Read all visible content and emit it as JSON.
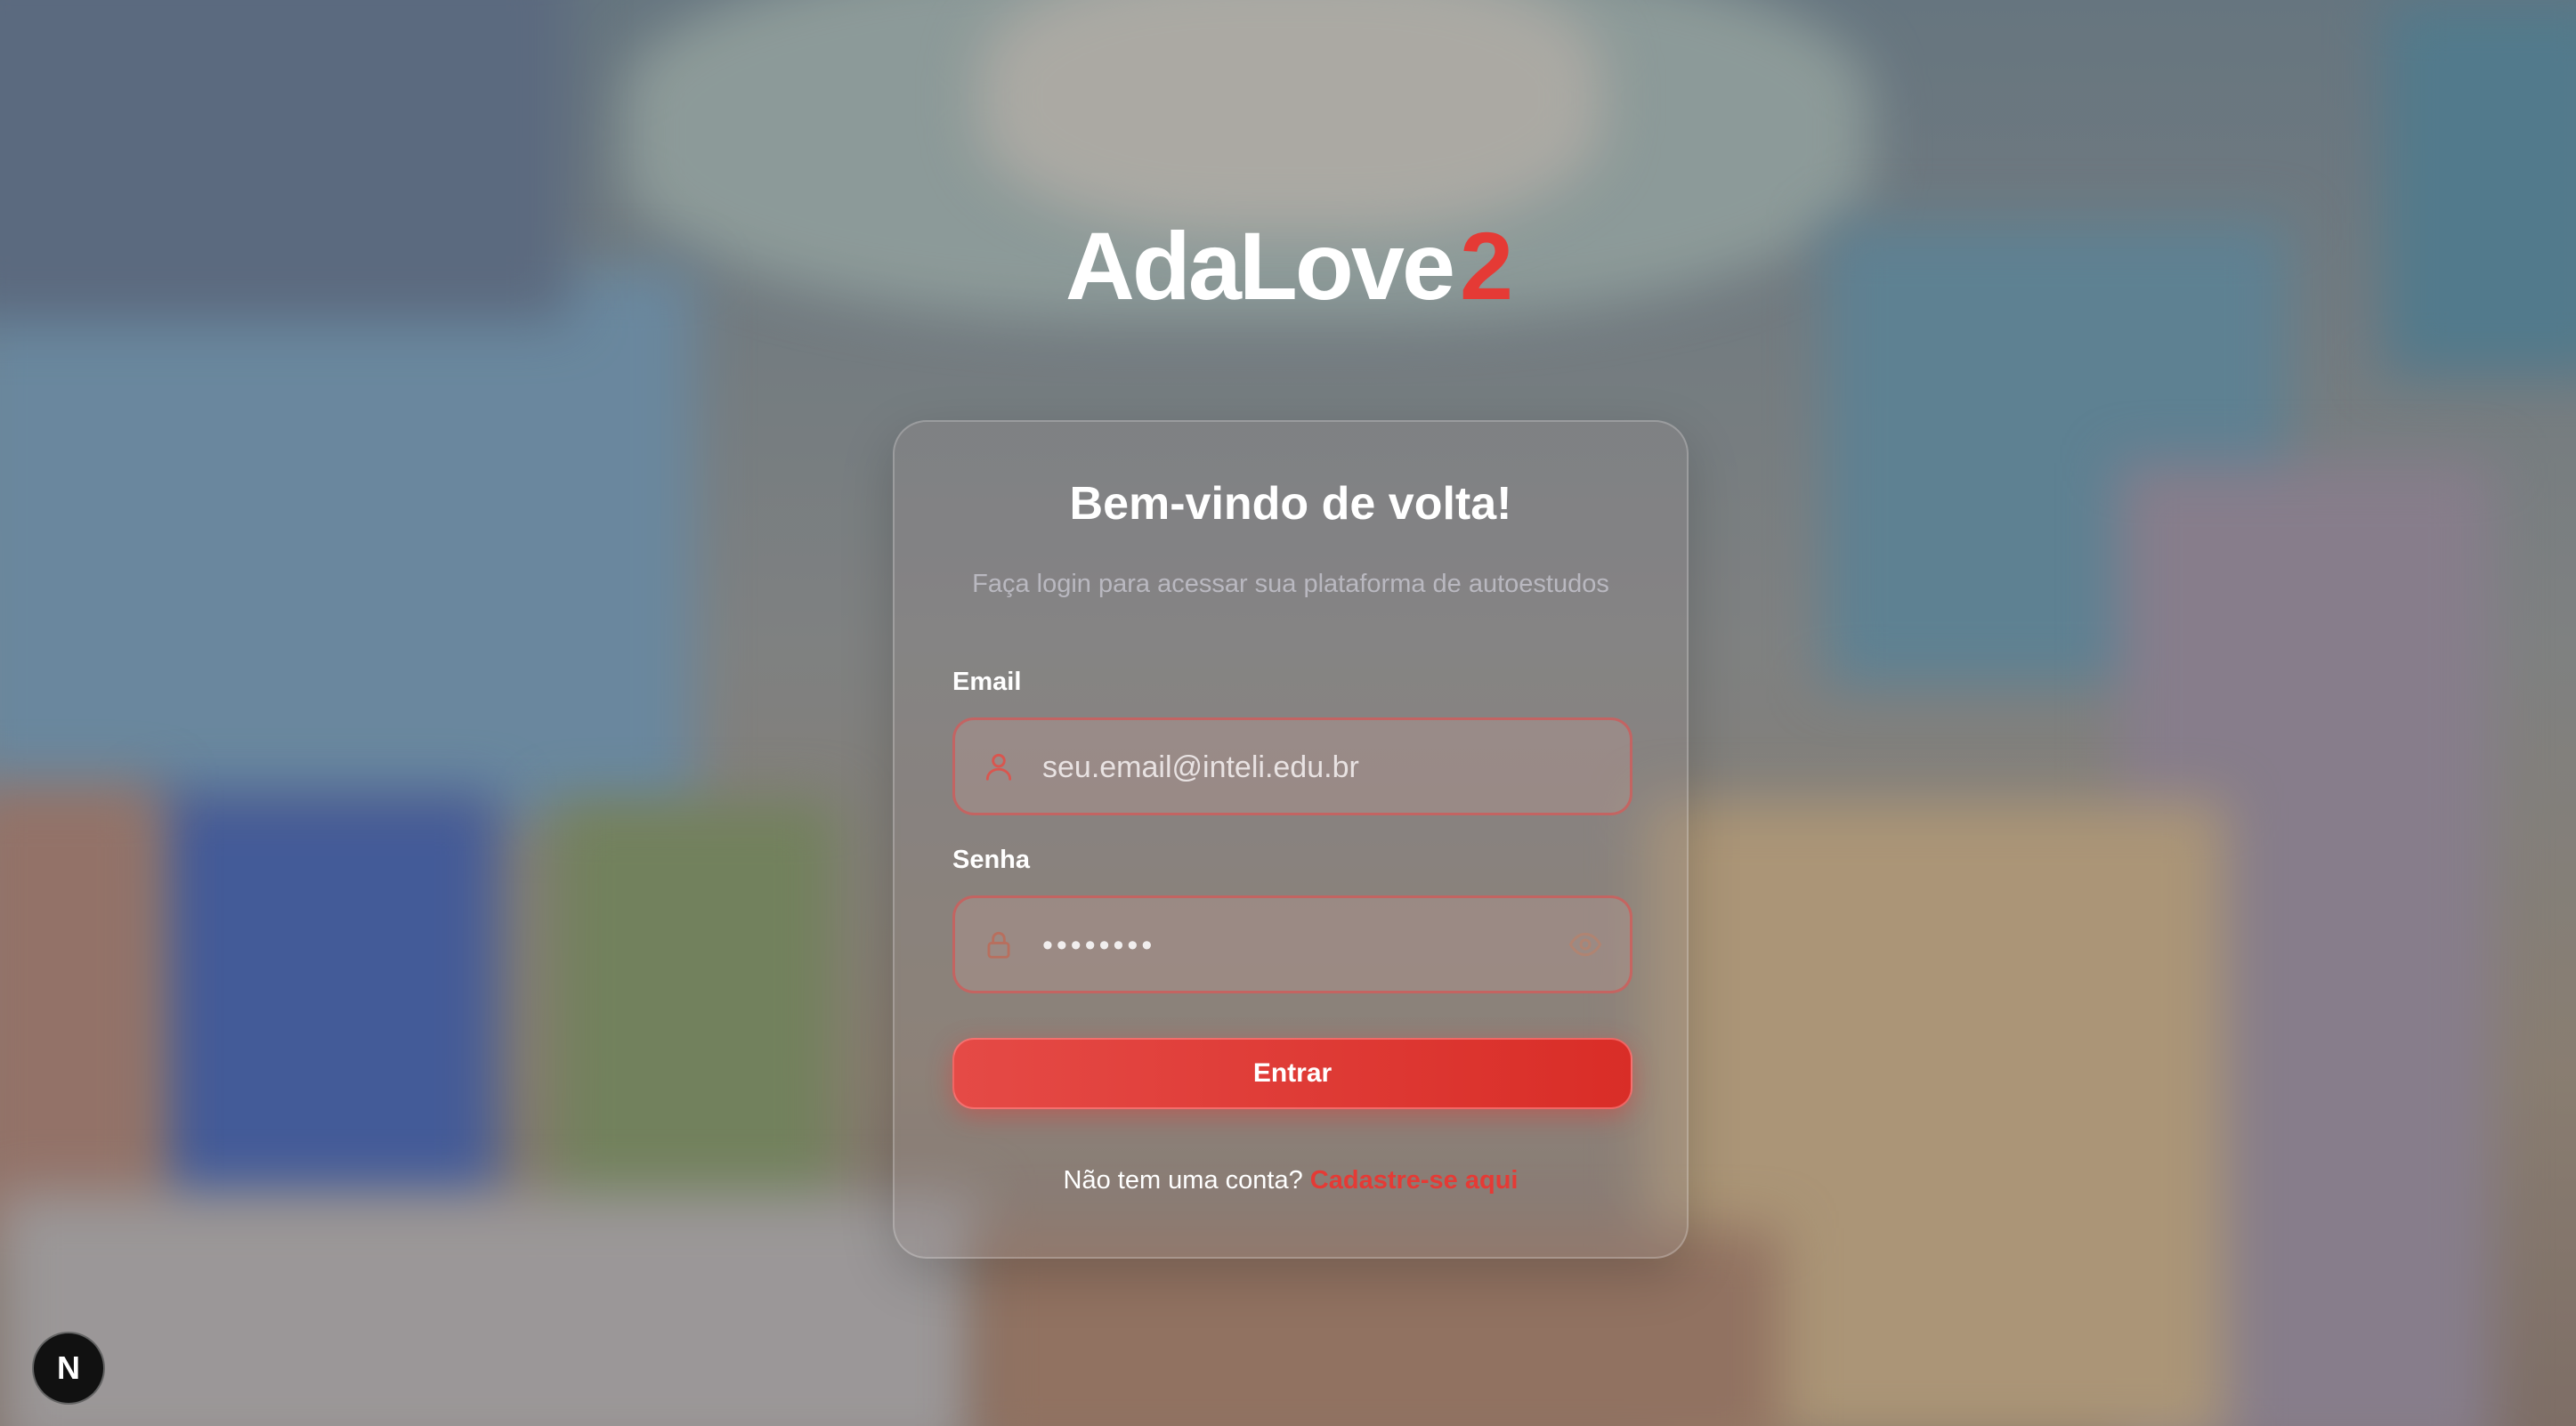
{
  "logo": {
    "text": "AdaLove",
    "number": "2"
  },
  "card": {
    "title": "Bem-vindo de volta!",
    "subtitle": "Faça login para acessar sua plataforma de autoestudos"
  },
  "form": {
    "email_label": "Email",
    "email_placeholder": "seu.email@inteli.edu.br",
    "email_icon": "user-icon",
    "password_label": "Senha",
    "password_value": "••••••••",
    "password_icon": "lock-icon",
    "toggle_icon": "eye-icon",
    "submit_label": "Entrar"
  },
  "signup": {
    "prompt": "Não tem uma conta?",
    "link_label": "Cadastre-se aqui"
  },
  "dev_badge": {
    "label": "N"
  },
  "colors": {
    "accent": "#e53a35",
    "text": "#ffffff",
    "muted": "#b9b8c0"
  }
}
